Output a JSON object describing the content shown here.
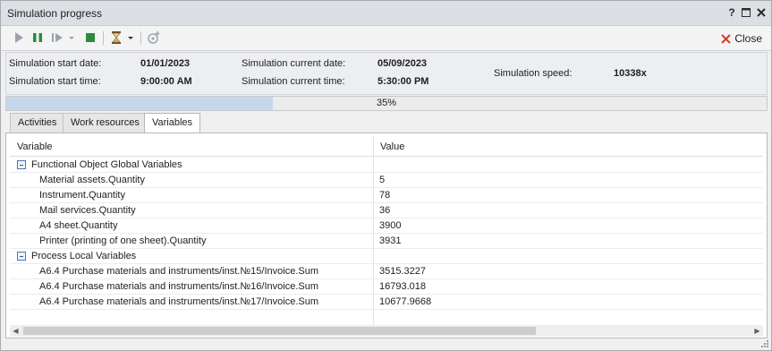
{
  "window": {
    "title": "Simulation progress",
    "help_label": "?",
    "close_label": "Close"
  },
  "toolbar": {
    "icons": [
      "play-icon",
      "pause-icon",
      "step-icon",
      "dropdown-arrow-icon",
      "stop-icon",
      "hourglass-icon",
      "dropdown-arrow-icon",
      "add-event-icon"
    ]
  },
  "info": {
    "start_date_label": "Simulation start date:",
    "start_date_value": "01/01/2023",
    "start_time_label": "Simulation start time:",
    "start_time_value": "9:00:00 AM",
    "current_date_label": "Simulation current date:",
    "current_date_value": "05/09/2023",
    "current_time_label": "Simulation current time:",
    "current_time_value": "5:30:00 PM",
    "speed_label": "Simulation speed:",
    "speed_value": "10338x"
  },
  "progress": {
    "percent": 35,
    "label": "35%"
  },
  "tabs": [
    {
      "label": "Activities",
      "active": false
    },
    {
      "label": "Work resources",
      "active": false
    },
    {
      "label": "Variables",
      "active": true
    }
  ],
  "grid": {
    "columns": [
      "Variable",
      "Value"
    ],
    "groups": [
      {
        "name": "Functional Object Global Variables",
        "rows": [
          {
            "name": "Material assets.Quantity",
            "value": "5"
          },
          {
            "name": "Instrument.Quantity",
            "value": "78"
          },
          {
            "name": "Mail services.Quantity",
            "value": "36"
          },
          {
            "name": "A4 sheet.Quantity",
            "value": "3900"
          },
          {
            "name": "Printer (printing of one sheet).Quantity",
            "value": "3931"
          }
        ]
      },
      {
        "name": "Process Local Variables",
        "rows": [
          {
            "name": "A6.4 Purchase materials and instruments/inst.№15/Invoice.Sum",
            "value": "3515.3227"
          },
          {
            "name": "A6.4 Purchase materials and instruments/inst.№16/Invoice.Sum",
            "value": "16793.018"
          },
          {
            "name": "A6.4 Purchase materials and instruments/inst.№17/Invoice.Sum",
            "value": "10677.9668"
          }
        ]
      }
    ]
  },
  "colors": {
    "progress_fill": "#c6d7ec",
    "play": "#9aa3ad",
    "pause": "#2e8b3e",
    "stop": "#2e8b3e",
    "close_x": "#d03a2a"
  }
}
